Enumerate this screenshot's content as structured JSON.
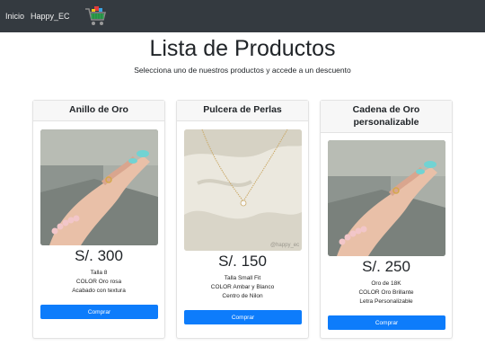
{
  "nav": {
    "links": [
      "Inicio",
      "Happy_EC"
    ],
    "cart_icon": "shopping-cart-icon"
  },
  "header": {
    "title": "Lista de Productos",
    "subtitle": "Selecciona uno de nuestros productos y accede a un descuento"
  },
  "products": [
    {
      "name": "Anillo de Oro",
      "price": "S/. 300",
      "details": [
        "Talla 8",
        "COLOR Oro rosa",
        "Acabado con textura"
      ],
      "button": "Comprar",
      "image": "hand-with-ring-photo"
    },
    {
      "name": "Pulcera de Perlas",
      "price": "S/. 150",
      "details": [
        "Talla Small Fit",
        "COLOR Ambar y Blanco",
        "Centro de Nilon"
      ],
      "button": "Comprar",
      "image": "necklace-on-fabric-photo",
      "watermark": "@happy_ec"
    },
    {
      "name": "Cadena de Oro personalizable",
      "price": "S/. 250",
      "details": [
        "Oro de 18K",
        "COLOR Oro Brillante",
        "Letra Personalizable"
      ],
      "button": "Comprar",
      "image": "hand-with-ring-photo"
    }
  ],
  "colors": {
    "navbar": "#343a40",
    "button": "#0d7cfb",
    "card_header": "#f7f7f7"
  }
}
